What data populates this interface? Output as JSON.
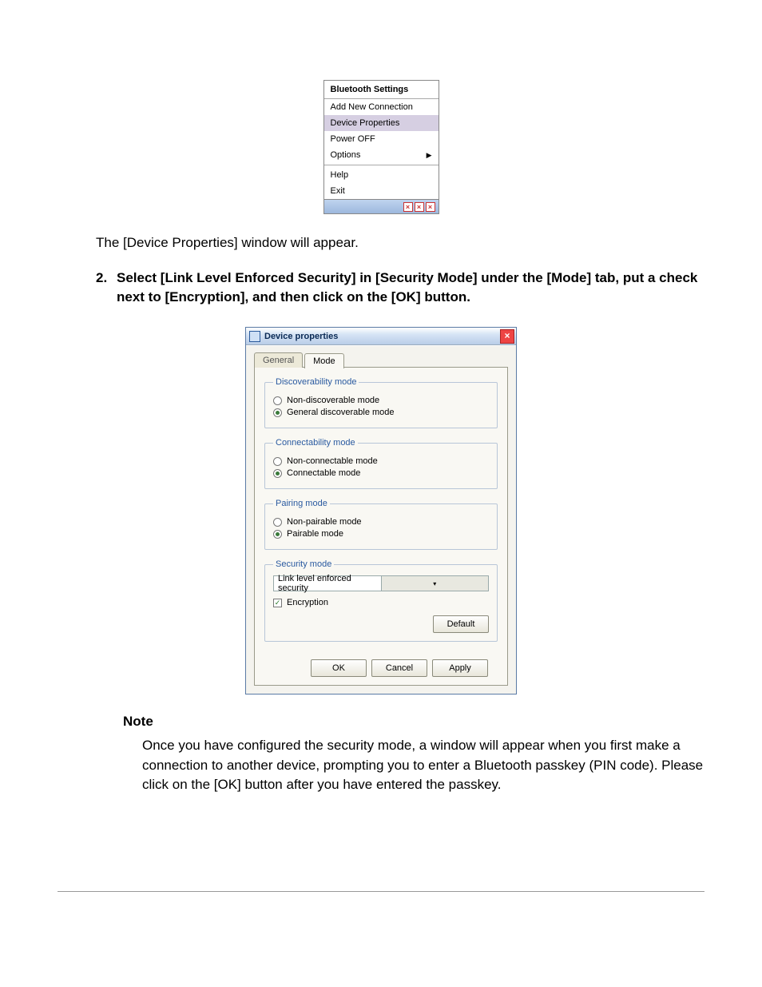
{
  "context_menu": {
    "title": "Bluetooth Settings",
    "items": [
      {
        "label": "Add New Connection",
        "selected": false,
        "submenu": false
      },
      {
        "label": "Device Properties",
        "selected": true,
        "submenu": false
      },
      {
        "label": "Power OFF",
        "selected": false,
        "submenu": false
      },
      {
        "label": "Options",
        "selected": false,
        "submenu": true
      }
    ],
    "footer_items": [
      {
        "label": "Help"
      },
      {
        "label": "Exit"
      }
    ]
  },
  "narrative": {
    "after_menu": "The [Device Properties] window will appear.",
    "step_number": "2.",
    "step_text": "Select [Link Level Enforced Security] in [Security Mode] under the [Mode] tab, put a check next to [Encryption], and then click on the [OK] button.",
    "note_heading": "Note",
    "note_body": "Once you have configured the security mode, a window will appear when you first make a connection to another device, prompting you to enter a Bluetooth passkey (PIN code). Please click on the [OK] button after you have entered the passkey."
  },
  "dialog": {
    "title": "Device properties",
    "tabs": {
      "general": "General",
      "mode": "Mode"
    },
    "groups": {
      "discoverability": {
        "legend": "Discoverability mode",
        "opt1": "Non-discoverable mode",
        "opt2": "General discoverable mode"
      },
      "connectability": {
        "legend": "Connectability mode",
        "opt1": "Non-connectable mode",
        "opt2": "Connectable mode"
      },
      "pairing": {
        "legend": "Pairing mode",
        "opt1": "Non-pairable mode",
        "opt2": "Pairable mode"
      },
      "security": {
        "legend": "Security mode",
        "combo": "Link level enforced security",
        "encryption": "Encryption",
        "default_btn": "Default"
      }
    },
    "buttons": {
      "ok": "OK",
      "cancel": "Cancel",
      "apply": "Apply"
    }
  }
}
